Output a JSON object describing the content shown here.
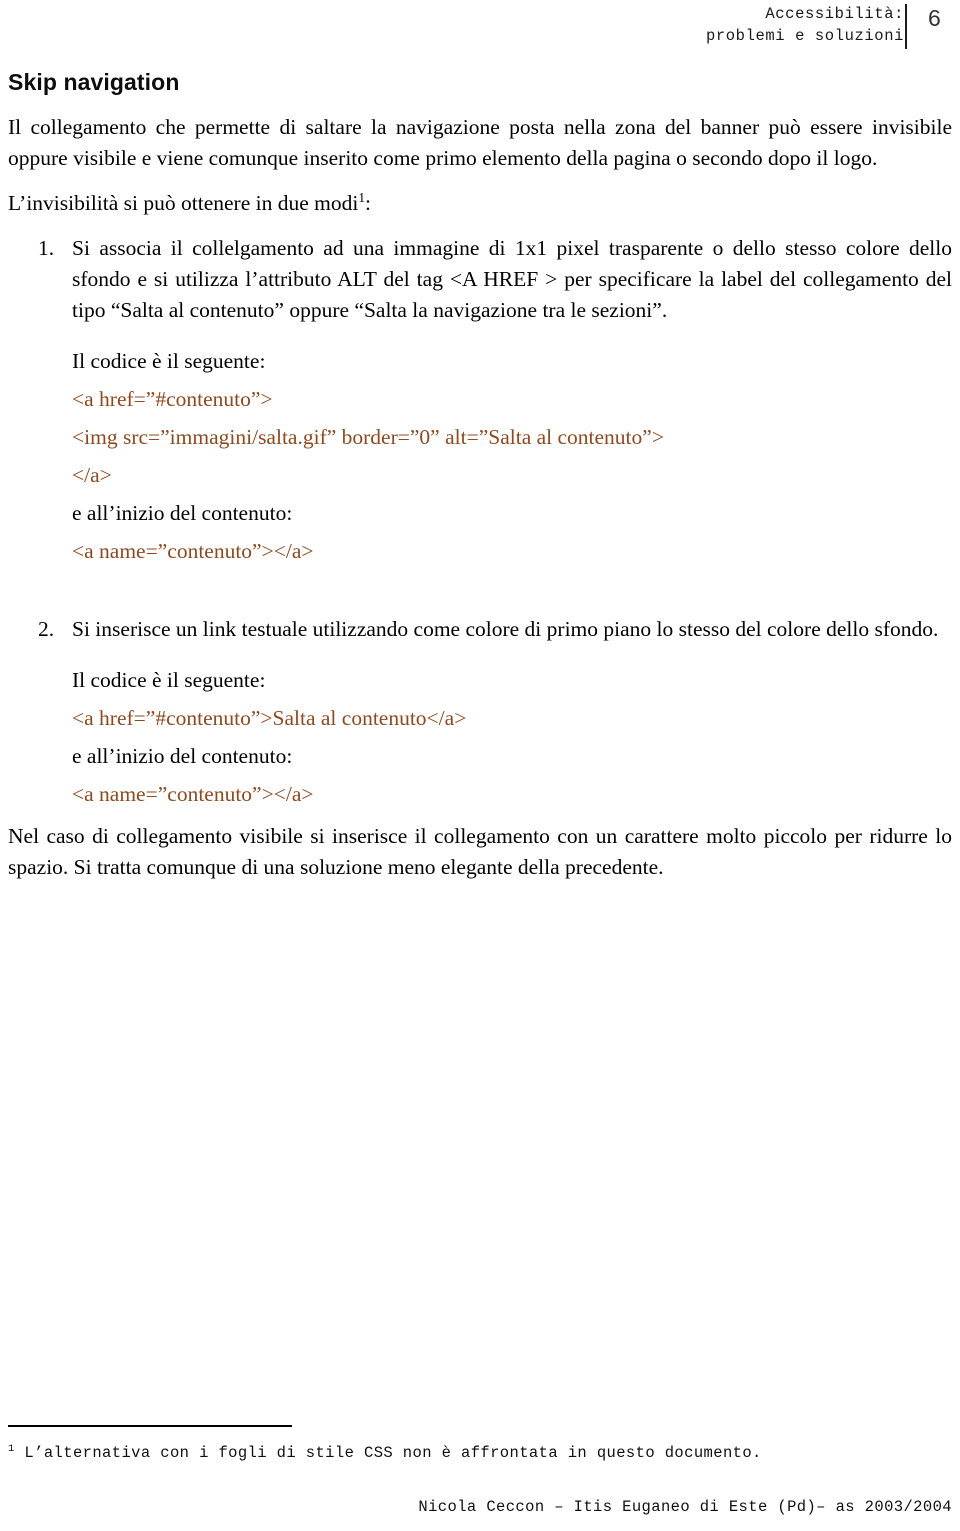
{
  "header": {
    "title": "Accessibilità:\nproblemi e soluzioni",
    "page_number": "6"
  },
  "section": {
    "title": "Skip navigation",
    "intro_paragraph": "Il collegamento che permette di saltare la navigazione posta nella zona del banner può essere invisibile oppure visibile e viene comunque inserito come primo elemento della pagina o secondo dopo il logo.",
    "modes_lead_before": "L’invisibilità si può ottenere in due modi",
    "modes_lead_footnote_marker": "1",
    "modes_lead_after": ":"
  },
  "steps": [
    {
      "marker": "1.",
      "text": "Si associa il collelgamento ad una immagine di 1x1 pixel trasparente o dello stesso colore dello sfondo e si utilizza l’attributo ALT del tag <A HREF > per specificare la label del collegamento del tipo “Salta al contenuto” oppure “Salta la navigazione tra le sezioni”.",
      "code_intro": "Il codice è il seguente:",
      "code_lines": [
        "<a href=”#contenuto”>",
        "<img src=”immagini/salta.gif” border=”0” alt=”Salta al contenuto”>",
        "</a>"
      ],
      "anchor_intro": "e all’inizio del contenuto:",
      "anchor_code": "<a name=”contenuto”></a>"
    },
    {
      "marker": "2.",
      "text": "Si inserisce un link testuale utilizzando come colore di primo piano lo stesso del colore dello sfondo.",
      "code_intro": "Il codice è il seguente:",
      "code_lines": [
        "<a href=”#contenuto”>Salta al contenuto</a>"
      ],
      "anchor_intro": "e all’inizio del contenuto:",
      "anchor_code": "<a name=”contenuto”></a>"
    }
  ],
  "closing_paragraph": "Nel caso di collegamento visibile si inserisce il collegamento con un carattere molto piccolo per ridurre lo spazio. Si tratta comunque di una soluzione meno elegante della precedente.",
  "footnote": {
    "marker": "1",
    "text": " L’alternativa con i fogli di stile CSS non è affrontata in questo documento."
  },
  "footer": {
    "credit": "Nicola Ceccon – Itis Euganeo di Este (Pd)– as 2003/2004"
  },
  "colors": {
    "code_text": "#8c4a22",
    "body_text": "#000000",
    "page_background": "#ffffff"
  }
}
